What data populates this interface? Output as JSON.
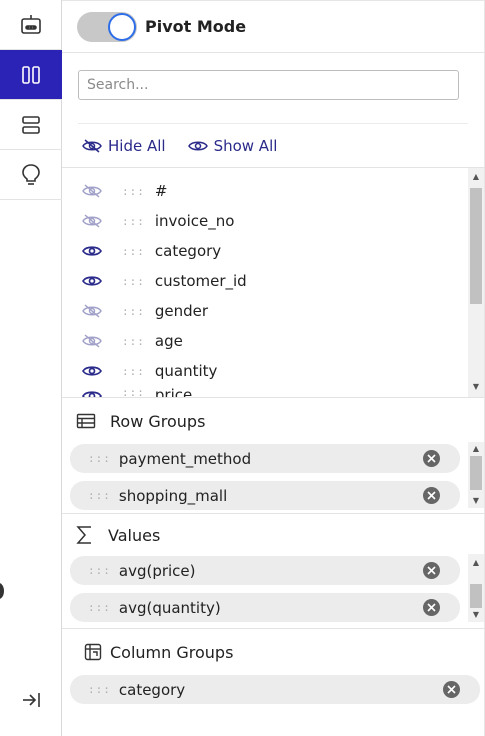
{
  "rail": {
    "items": [
      {
        "icon": "robot-icon"
      },
      {
        "icon": "columns-icon",
        "active": true
      },
      {
        "icon": "rows-icon"
      },
      {
        "icon": "lightbulb-icon"
      }
    ],
    "bottom_icon": "collapse-panel-icon"
  },
  "pivot": {
    "label": "Pivot Mode",
    "enabled": true
  },
  "search": {
    "placeholder": "Search..."
  },
  "visibility": {
    "hide_all": "Hide All",
    "show_all": "Show All"
  },
  "columns": [
    {
      "name": "#",
      "visible": false
    },
    {
      "name": "invoice_no",
      "visible": false
    },
    {
      "name": "category",
      "visible": true
    },
    {
      "name": "customer_id",
      "visible": true
    },
    {
      "name": "gender",
      "visible": false
    },
    {
      "name": "age",
      "visible": false
    },
    {
      "name": "quantity",
      "visible": true
    },
    {
      "name": "price",
      "visible": true
    }
  ],
  "row_groups": {
    "title": "Row Groups",
    "items": [
      "payment_method",
      "shopping_mall"
    ]
  },
  "values": {
    "title": "Values",
    "items": [
      "avg(price)",
      "avg(quantity)"
    ]
  },
  "column_groups": {
    "title": "Column Groups",
    "items": [
      "category"
    ]
  },
  "colors": {
    "accent": "#2b22b6",
    "link": "#2a2a8a",
    "toggle_ring": "#2d6ee8",
    "chip_bg": "#ececec"
  }
}
